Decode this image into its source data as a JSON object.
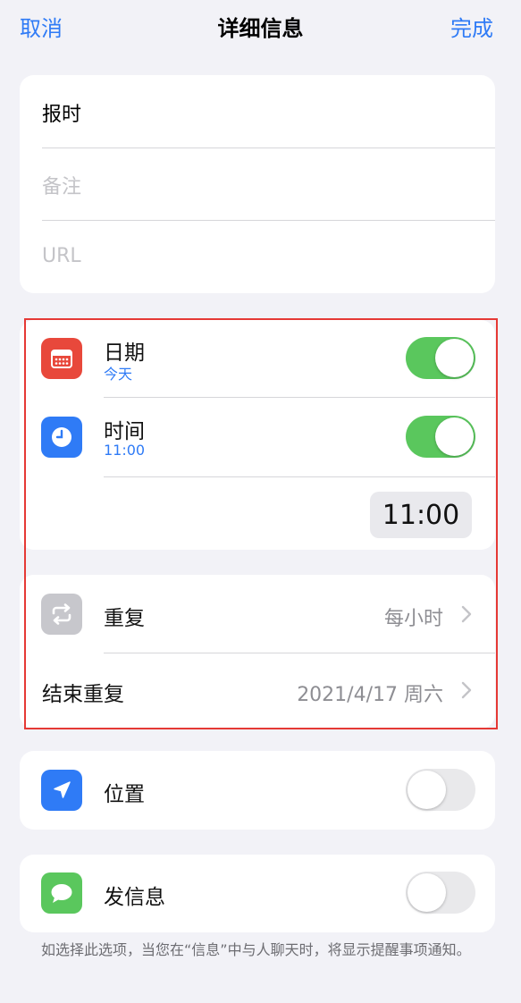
{
  "nav": {
    "cancel_label": "取消",
    "title": "详细信息",
    "done_label": "完成"
  },
  "details": {
    "title_value": "报时",
    "notes_placeholder": "备注",
    "url_placeholder": "URL"
  },
  "datetime": {
    "date_label": "日期",
    "date_value": "今天",
    "date_enabled": true,
    "time_label": "时间",
    "time_value": "11:00",
    "time_enabled": true,
    "time_picker_value": "11:00"
  },
  "repeat": {
    "repeat_label": "重复",
    "repeat_value": "每小时",
    "end_repeat_label": "结束重复",
    "end_repeat_value": "2021/4/17 周六"
  },
  "location": {
    "label": "位置",
    "enabled": false
  },
  "messaging": {
    "label": "发信息",
    "enabled": false,
    "footnote": "如选择此选项，当您在“信息”中与人聊天时，将显示提醒事项通知。"
  },
  "colors": {
    "accent": "#2f7bf6",
    "toggle_on": "#5ac75d",
    "calendar_icon": "#e8483b",
    "clock_icon": "#2f7bf6",
    "repeat_icon": "#c7c7cc",
    "location_icon": "#2f7bf6",
    "message_icon": "#5ac75d",
    "highlight_border": "#e53935"
  }
}
